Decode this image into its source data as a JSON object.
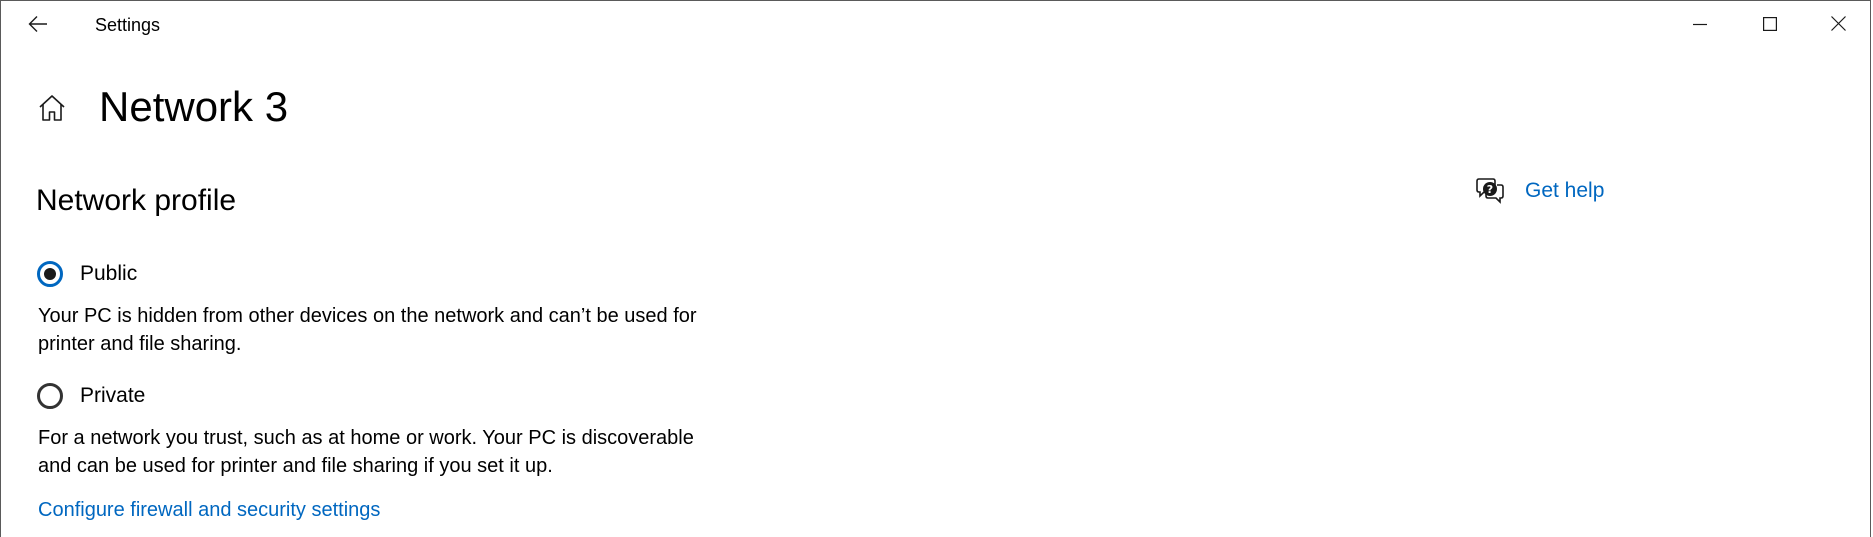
{
  "window": {
    "title": "Settings",
    "controls": {
      "minimize": "minimize-icon",
      "maximize": "maximize-icon",
      "close": "close-icon"
    }
  },
  "header": {
    "back_icon": "back-arrow-icon",
    "home_icon": "home-icon",
    "title": "Network 3"
  },
  "network_profile": {
    "heading": "Network profile",
    "options": [
      {
        "label": "Public",
        "selected": true,
        "description": "Your PC is hidden from other devices on the network and can’t be used for printer and file sharing."
      },
      {
        "label": "Private",
        "selected": false,
        "description": "For a network you trust, such as at home or work. Your PC is discoverable and can be used for printer and file sharing if you set it up."
      }
    ],
    "firewall_link": "Configure firewall and security settings"
  },
  "help": {
    "icon": "chat-help-icon",
    "label": "Get help"
  },
  "colors": {
    "accent": "#0067c0",
    "text": "#000000",
    "background": "#ffffff"
  }
}
